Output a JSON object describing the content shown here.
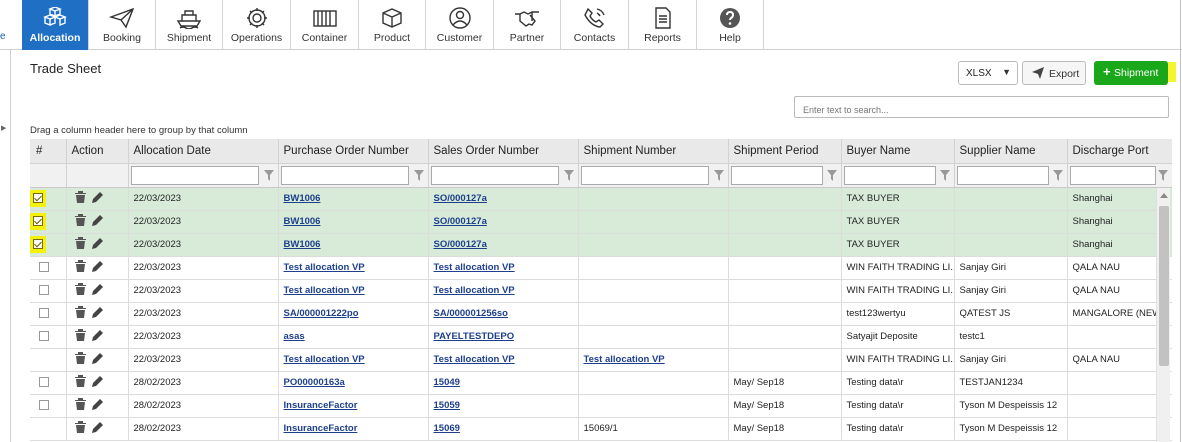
{
  "nav": {
    "edge_label": "e",
    "items": [
      {
        "label": "Allocation",
        "icon": "cubes-icon",
        "active": true
      },
      {
        "label": "Booking",
        "icon": "paper-plane-icon"
      },
      {
        "label": "Shipment",
        "icon": "ship-icon"
      },
      {
        "label": "Operations",
        "icon": "gear-icon"
      },
      {
        "label": "Container",
        "icon": "container-icon"
      },
      {
        "label": "Product",
        "icon": "box-icon"
      },
      {
        "label": "Customer",
        "icon": "user-icon"
      },
      {
        "label": "Partner",
        "icon": "handshake-icon"
      },
      {
        "label": "Contacts",
        "icon": "phone-icon"
      },
      {
        "label": "Reports",
        "icon": "report-icon"
      },
      {
        "label": "Help",
        "icon": "help-icon"
      }
    ]
  },
  "page": {
    "title": "Trade Sheet"
  },
  "toolbar": {
    "format_value": "XLSX",
    "export_label": "Export",
    "shipment_label": "Shipment",
    "shipment_color": "#1aa81a"
  },
  "search": {
    "placeholder": "Enter text to search..."
  },
  "grid": {
    "group_hint": "Drag a column header here to group by that column",
    "columns": [
      "#",
      "Action",
      "Allocation Date",
      "Purchase Order Number",
      "Sales Order Number",
      "Shipment Number",
      "Shipment Period",
      "Buyer Name",
      "Supplier Name",
      "Discharge Port"
    ],
    "rows": [
      {
        "checkbox": "checked",
        "selected": true,
        "date": "22/03/2023",
        "po": "BW1006",
        "so": "SO/000127a",
        "shipment": "",
        "period": "",
        "buyer": "TAX BUYER",
        "supplier": "",
        "port": "Shanghai"
      },
      {
        "checkbox": "checked",
        "selected": true,
        "date": "22/03/2023",
        "po": "BW1006",
        "so": "SO/000127a",
        "shipment": "",
        "period": "",
        "buyer": "TAX BUYER",
        "supplier": "",
        "port": "Shanghai"
      },
      {
        "checkbox": "checked",
        "selected": true,
        "date": "22/03/2023",
        "po": "BW1006",
        "so": "SO/000127a",
        "shipment": "",
        "period": "",
        "buyer": "TAX BUYER",
        "supplier": "",
        "port": "Shanghai"
      },
      {
        "checkbox": "unchecked",
        "selected": false,
        "date": "22/03/2023",
        "po": "Test allocation VP",
        "so": "Test allocation VP",
        "shipment": "",
        "period": "",
        "buyer": "WIN FAITH TRADING LI...",
        "supplier": "Sanjay Giri",
        "port": "QALA NAU"
      },
      {
        "checkbox": "unchecked",
        "selected": false,
        "date": "22/03/2023",
        "po": "Test allocation VP",
        "so": "Test allocation VP",
        "shipment": "",
        "period": "",
        "buyer": "WIN FAITH TRADING LI...",
        "supplier": "Sanjay Giri",
        "port": "QALA NAU"
      },
      {
        "checkbox": "unchecked",
        "selected": false,
        "date": "22/03/2023",
        "po": "SA/000001222po",
        "so": "SA/000001256so",
        "shipment": "",
        "period": "",
        "buyer": "test123wertyu",
        "supplier": "QATEST JS",
        "port": "MANGALORE (NEW I"
      },
      {
        "checkbox": "unchecked",
        "selected": false,
        "date": "22/03/2023",
        "po": "asas",
        "so": "PAYELTESTDEPO",
        "shipment": "",
        "period": "",
        "buyer": "Satyajit Deposite",
        "supplier": "testc1",
        "port": ""
      },
      {
        "checkbox": "none",
        "selected": false,
        "date": "22/03/2023",
        "po": "Test allocation VP",
        "so": "Test allocation VP",
        "shipment": "Test allocation VP",
        "shipment_link": true,
        "period": "",
        "buyer": "WIN FAITH TRADING LI...",
        "supplier": "Sanjay Giri",
        "port": "QALA NAU"
      },
      {
        "checkbox": "unchecked",
        "selected": false,
        "date": "28/02/2023",
        "po": "PO00000163a",
        "so": "15049",
        "shipment": "",
        "period": "May/ Sep18",
        "buyer": "Testing data\\r",
        "supplier": "TESTJAN1234",
        "port": ""
      },
      {
        "checkbox": "unchecked",
        "selected": false,
        "date": "28/02/2023",
        "po": "InsuranceFactor",
        "so": "15059",
        "shipment": "",
        "period": "May/ Sep18",
        "buyer": "Testing data\\r",
        "supplier": "Tyson M Despeissis 12",
        "port": ""
      },
      {
        "checkbox": "none",
        "selected": false,
        "date": "28/02/2023",
        "po": "InsuranceFactor",
        "so": "15069",
        "shipment": "15069/1",
        "shipment_link": false,
        "period": "May/ Sep18",
        "buyer": "Testing data\\r",
        "supplier": "Tyson M Despeissis 12",
        "port": ""
      }
    ]
  }
}
